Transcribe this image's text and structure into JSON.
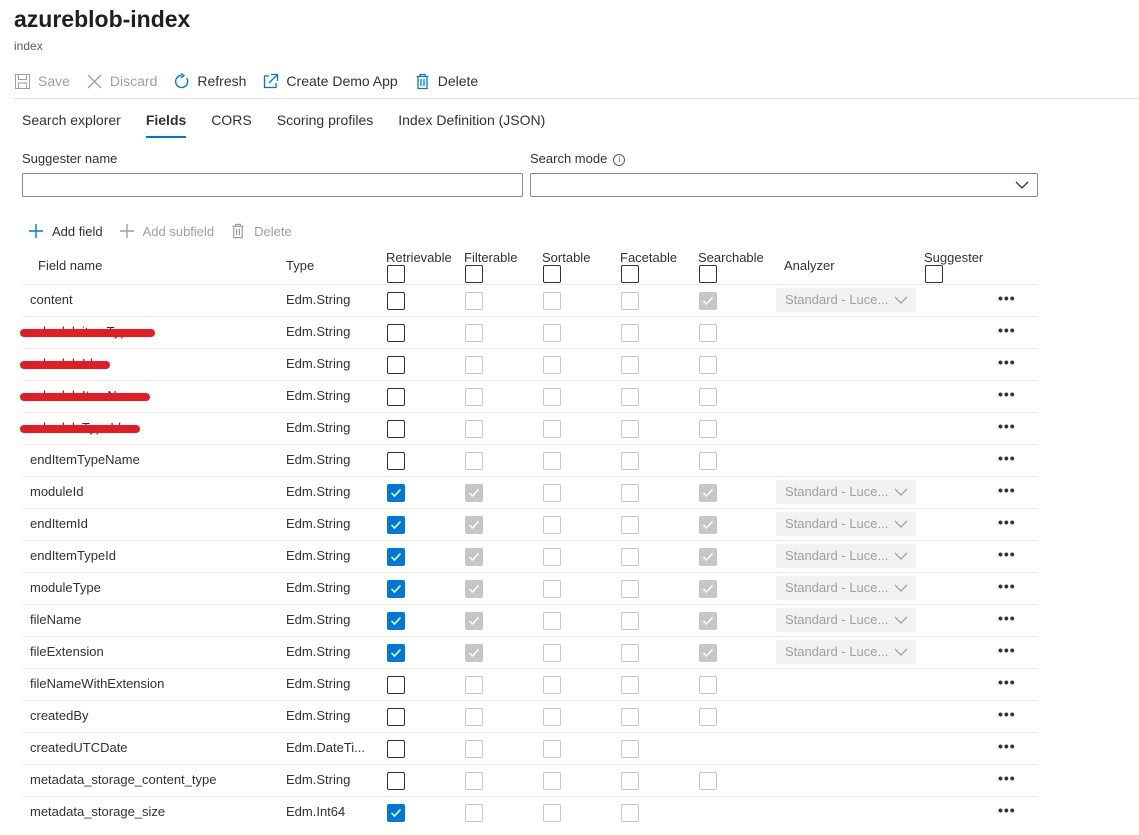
{
  "page": {
    "title": "azureblob-index",
    "subtitle": "index"
  },
  "toolbar": {
    "save": "Save",
    "discard": "Discard",
    "refresh": "Refresh",
    "create_demo_app": "Create Demo App",
    "delete": "Delete"
  },
  "tabs": [
    "Search explorer",
    "Fields",
    "CORS",
    "Scoring profiles",
    "Index Definition (JSON)"
  ],
  "active_tab": "Fields",
  "suggester": {
    "name_label": "Suggester name",
    "name_value": "",
    "mode_label": "Search mode",
    "mode_value": ""
  },
  "field_actions": {
    "add_field": "Add field",
    "add_subfield": "Add subfield",
    "delete": "Delete"
  },
  "columns": {
    "field_name": "Field name",
    "type": "Type",
    "retrievable": "Retrievable",
    "filterable": "Filterable",
    "sortable": "Sortable",
    "facetable": "Facetable",
    "searchable": "Searchable",
    "analyzer": "Analyzer",
    "suggester": "Suggester"
  },
  "colors": {
    "accent": "#0078d4",
    "redaction": "#e31c23",
    "disabled": "#c8c6c4"
  },
  "rows": [
    {
      "name": "content",
      "type": "Edm.String",
      "retrievable": false,
      "filterable": false,
      "sortable": false,
      "facetable": false,
      "searchable": "checked",
      "analyzer": "Standard - Luce...",
      "redacted": false
    },
    {
      "name": "scheduleitemType",
      "type": "Edm.String",
      "retrievable": false,
      "filterable": false,
      "sortable": false,
      "facetable": false,
      "searchable": "empty",
      "analyzer": "",
      "redacted": true
    },
    {
      "name": "scheduleId",
      "type": "Edm.String",
      "retrievable": false,
      "filterable": false,
      "sortable": false,
      "facetable": false,
      "searchable": "empty",
      "analyzer": "",
      "redacted": true
    },
    {
      "name": "scheduleItemName",
      "type": "Edm.String",
      "retrievable": false,
      "filterable": false,
      "sortable": false,
      "facetable": false,
      "searchable": "empty",
      "analyzer": "",
      "redacted": true
    },
    {
      "name": "scheduleTypeId",
      "type": "Edm.String",
      "retrievable": false,
      "filterable": false,
      "sortable": false,
      "facetable": false,
      "searchable": "empty",
      "analyzer": "",
      "redacted": true
    },
    {
      "name": "endItemTypeName",
      "type": "Edm.String",
      "retrievable": false,
      "filterable": false,
      "sortable": false,
      "facetable": false,
      "searchable": "empty",
      "analyzer": "",
      "redacted": false
    },
    {
      "name": "moduleId",
      "type": "Edm.String",
      "retrievable": true,
      "filterable": true,
      "sortable": false,
      "facetable": false,
      "searchable": "checked",
      "analyzer": "Standard - Luce...",
      "redacted": false
    },
    {
      "name": "endItemId",
      "type": "Edm.String",
      "retrievable": true,
      "filterable": true,
      "sortable": false,
      "facetable": false,
      "searchable": "checked",
      "analyzer": "Standard - Luce...",
      "redacted": false
    },
    {
      "name": "endItemTypeId",
      "type": "Edm.String",
      "retrievable": true,
      "filterable": true,
      "sortable": false,
      "facetable": false,
      "searchable": "checked",
      "analyzer": "Standard - Luce...",
      "redacted": false
    },
    {
      "name": "moduleType",
      "type": "Edm.String",
      "retrievable": true,
      "filterable": true,
      "sortable": false,
      "facetable": false,
      "searchable": "checked",
      "analyzer": "Standard - Luce...",
      "redacted": false
    },
    {
      "name": "fileName",
      "type": "Edm.String",
      "retrievable": true,
      "filterable": true,
      "sortable": false,
      "facetable": false,
      "searchable": "checked",
      "analyzer": "Standard - Luce...",
      "redacted": false
    },
    {
      "name": "fileExtension",
      "type": "Edm.String",
      "retrievable": true,
      "filterable": true,
      "sortable": false,
      "facetable": false,
      "searchable": "checked",
      "analyzer": "Standard - Luce...",
      "redacted": false
    },
    {
      "name": "fileNameWithExtension",
      "type": "Edm.String",
      "retrievable": false,
      "filterable": false,
      "sortable": false,
      "facetable": false,
      "searchable": "empty",
      "analyzer": "",
      "redacted": false
    },
    {
      "name": "createdBy",
      "type": "Edm.String",
      "retrievable": false,
      "filterable": false,
      "sortable": false,
      "facetable": false,
      "searchable": "empty",
      "analyzer": "",
      "redacted": false
    },
    {
      "name": "createdUTCDate",
      "type": "Edm.DateTi...",
      "retrievable": false,
      "filterable": false,
      "sortable": false,
      "facetable": false,
      "searchable": "none",
      "analyzer": "",
      "redacted": false
    },
    {
      "name": "metadata_storage_content_type",
      "type": "Edm.String",
      "retrievable": false,
      "filterable": false,
      "sortable": false,
      "facetable": false,
      "searchable": "empty",
      "analyzer": "",
      "redacted": false
    },
    {
      "name": "metadata_storage_size",
      "type": "Edm.Int64",
      "retrievable": true,
      "filterable": false,
      "sortable": false,
      "facetable": false,
      "searchable": "none",
      "analyzer": "",
      "redacted": false
    }
  ]
}
